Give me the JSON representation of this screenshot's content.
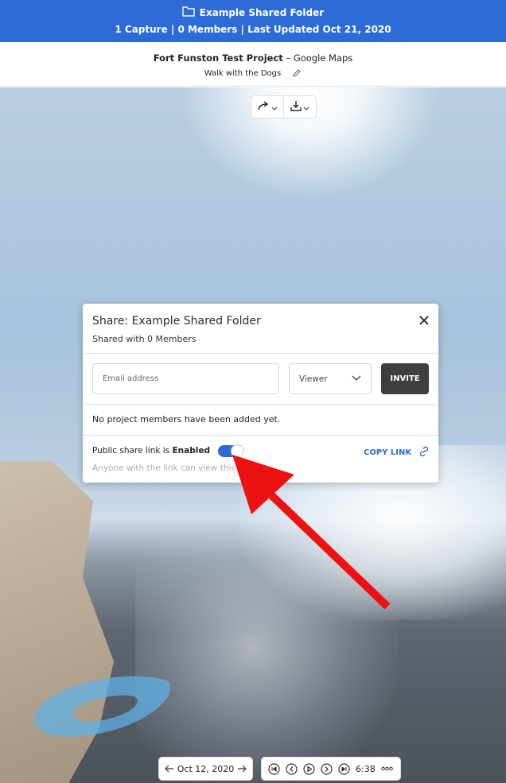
{
  "folder_bar": {
    "folder_name": "Example Shared Folder",
    "summary": "1 Capture | 0 Members | Last Updated Oct 21, 2020"
  },
  "project": {
    "name": "Fort Funston Test Project",
    "separator": " – ",
    "source": "Google Maps",
    "capture_title": "Walk with the Dogs"
  },
  "share_dialog": {
    "title": "Share: Example Shared Folder",
    "subtitle": "Shared with 0 Members",
    "email_placeholder": "Email address",
    "role_value": "Viewer",
    "invite_label": "INVITE",
    "no_members_text": "No project members have been added yet.",
    "public_link_prefix": "Public share link is ",
    "public_link_state": "Enabled",
    "public_link_enabled": true,
    "copy_link_label": "COPY LINK",
    "public_link_note": "Anyone with the link can view this folder"
  },
  "player": {
    "date": "Oct 12, 2020",
    "time": "6:38"
  },
  "colors": {
    "brand_blue": "#2d6bd7",
    "annotation_red": "#ee1111",
    "invite_button": "#3f3f3f"
  }
}
